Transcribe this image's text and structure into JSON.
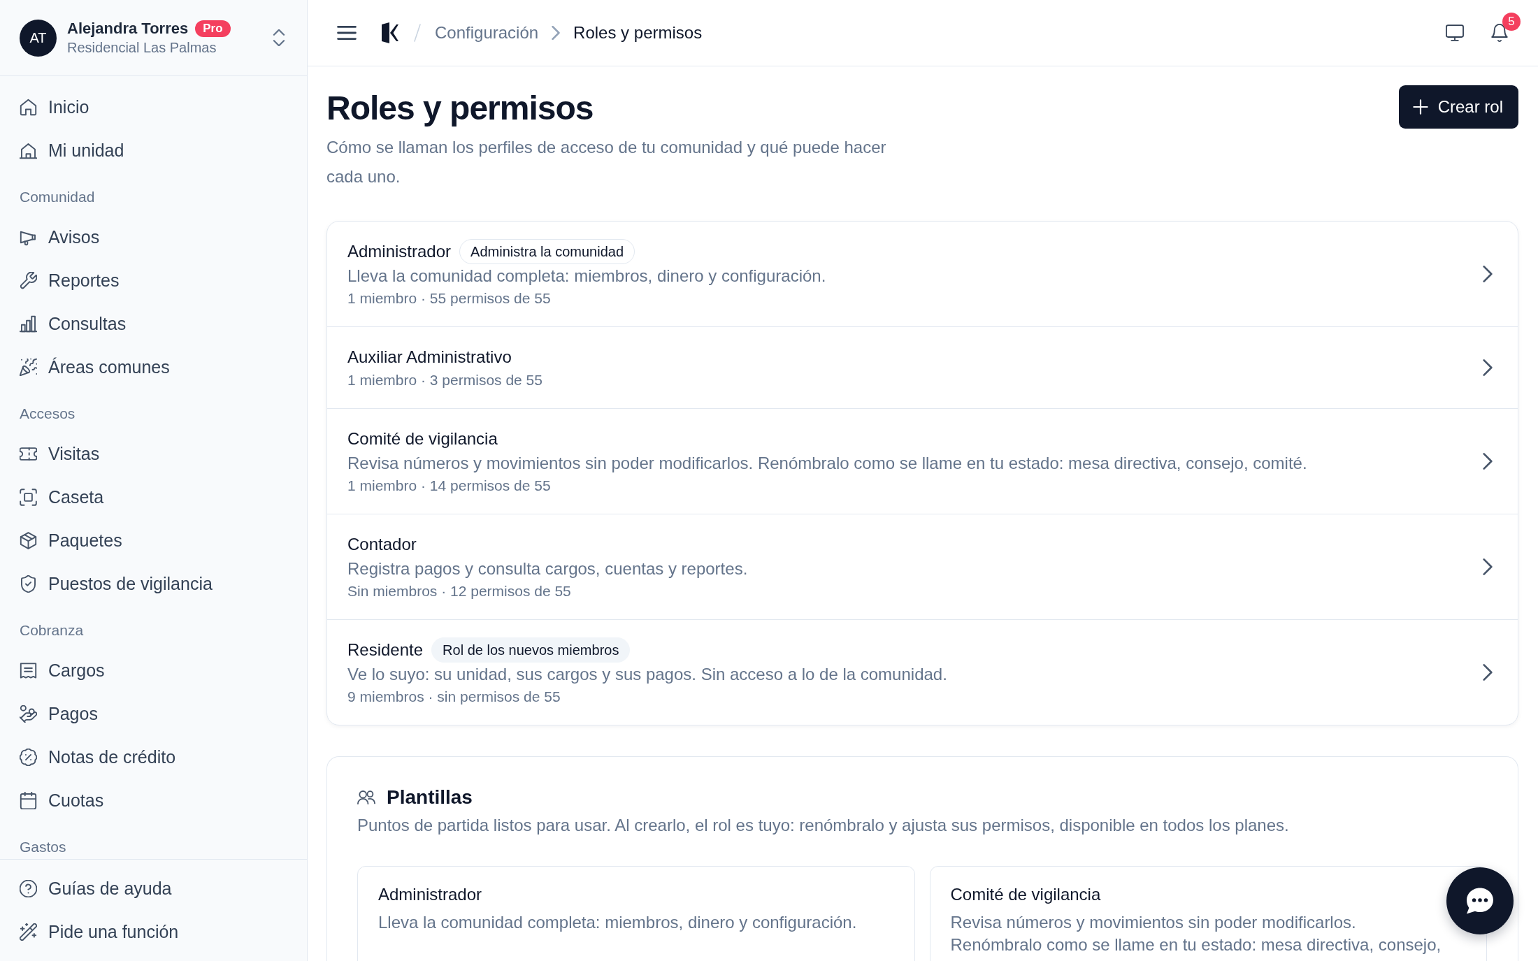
{
  "sidebar": {
    "account": {
      "initials": "AT",
      "name": "Alejandra Torres",
      "plan": "Pro",
      "community": "Residencial Las Palmas"
    },
    "groups": [
      {
        "items": [
          {
            "label": "Inicio",
            "selected": false
          },
          {
            "label": "Mi unidad",
            "selected": false
          }
        ]
      },
      {
        "title": "Comunidad",
        "items": [
          {
            "label": "Avisos",
            "selected": false
          },
          {
            "label": "Reportes",
            "selected": false
          },
          {
            "label": "Consultas",
            "selected": false
          },
          {
            "label": "Áreas comunes",
            "selected": false
          }
        ]
      },
      {
        "title": "Accesos",
        "items": [
          {
            "label": "Visitas",
            "selected": false
          },
          {
            "label": "Caseta",
            "selected": false
          },
          {
            "label": "Paquetes",
            "selected": false
          },
          {
            "label": "Puestos de vigilancia",
            "selected": false
          }
        ]
      },
      {
        "title": "Cobranza",
        "items": [
          {
            "label": "Cargos",
            "selected": false
          },
          {
            "label": "Pagos",
            "selected": false
          },
          {
            "label": "Notas de crédito",
            "selected": false
          },
          {
            "label": "Cuotas",
            "selected": false
          }
        ]
      },
      {
        "title": "Gastos"
      }
    ],
    "footer": [
      {
        "label": "Guías de ayuda"
      },
      {
        "label": "Pide una función"
      }
    ]
  },
  "topbar": {
    "breadcrumb": [
      {
        "label": "Configuración",
        "current": false
      },
      {
        "label": "Roles y permisos",
        "current": true
      }
    ],
    "notifications": "5"
  },
  "page": {
    "title": "Roles y permisos",
    "subtitle": "Cómo se llaman los perfiles de acceso de tu comunidad y qué puede hacer cada uno.",
    "action": "Crear rol"
  },
  "roles": [
    {
      "name": "Administrador",
      "tag": {
        "kind": "outline",
        "text": "Administra la comunidad"
      },
      "description": "Lleva la comunidad completa: miembros, dinero y configuración.",
      "meta": "1 miembro · 55 permisos de 55"
    },
    {
      "name": "Auxiliar Administrativo",
      "meta": "1 miembro · 3 permisos de 55"
    },
    {
      "name": "Comité de vigilancia",
      "description": "Revisa números y movimientos sin poder modificarlos. Renómbralo como se llame en tu estado: mesa directiva, consejo, comité.",
      "meta": "1 miembro · 14 permisos de 55"
    },
    {
      "name": "Contador",
      "description": "Registra pagos y consulta cargos, cuentas y reportes.",
      "meta": "Sin miembros · 12 permisos de 55"
    },
    {
      "name": "Residente",
      "tag": {
        "kind": "soft",
        "text": "Rol de los nuevos miembros"
      },
      "description": "Ve lo suyo: su unidad, sus cargos y sus pagos. Sin acceso a lo de la comunidad.",
      "meta": "9 miembros · sin permisos de 55"
    }
  ],
  "templates": {
    "title": "Plantillas",
    "description": "Puntos de partida listos para usar. Al crearlo, el rol es tuyo: renómbralo y ajusta sus permisos, disponible en todos los planes.",
    "items": [
      {
        "name": "Administrador",
        "description": "Lleva la comunidad completa: miembros, dinero y configuración."
      },
      {
        "name": "Comité de vigilancia",
        "description": "Revisa números y movimientos sin poder modificarlos. Renómbralo como se llame en tu estado: mesa directiva, consejo,"
      }
    ]
  }
}
